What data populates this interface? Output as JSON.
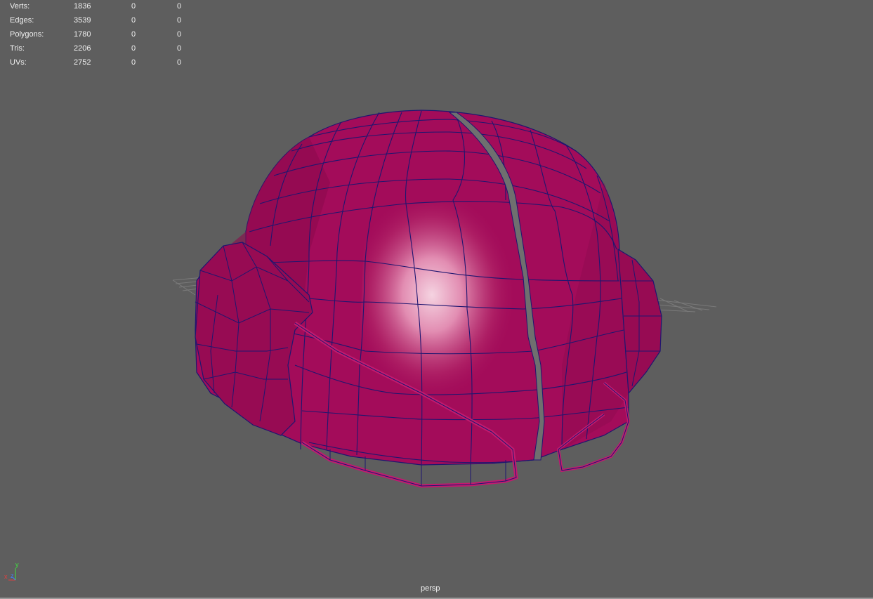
{
  "hud": {
    "rows": [
      {
        "label": "Verts:",
        "total": "1836",
        "selected": "0",
        "component": "0"
      },
      {
        "label": "Edges:",
        "total": "3539",
        "selected": "0",
        "component": "0"
      },
      {
        "label": "Polygons:",
        "total": "1780",
        "selected": "0",
        "component": "0"
      },
      {
        "label": "Tris:",
        "total": "2206",
        "selected": "0",
        "component": "0"
      },
      {
        "label": "UVs:",
        "total": "2752",
        "selected": "0",
        "component": "0"
      }
    ]
  },
  "viewport": {
    "camera_label": "persp",
    "background_color": "#5e5e5e"
  },
  "model": {
    "shaded_color": "#a30c5a",
    "wire_color": "#1e1670",
    "highlight_color": "#f2c6d8"
  },
  "axis_gizmo": {
    "x_label": "x",
    "y_label": "y",
    "z_label": "z",
    "x_color": "#e04040",
    "y_color": "#40e040",
    "z_color": "#4080ff"
  }
}
